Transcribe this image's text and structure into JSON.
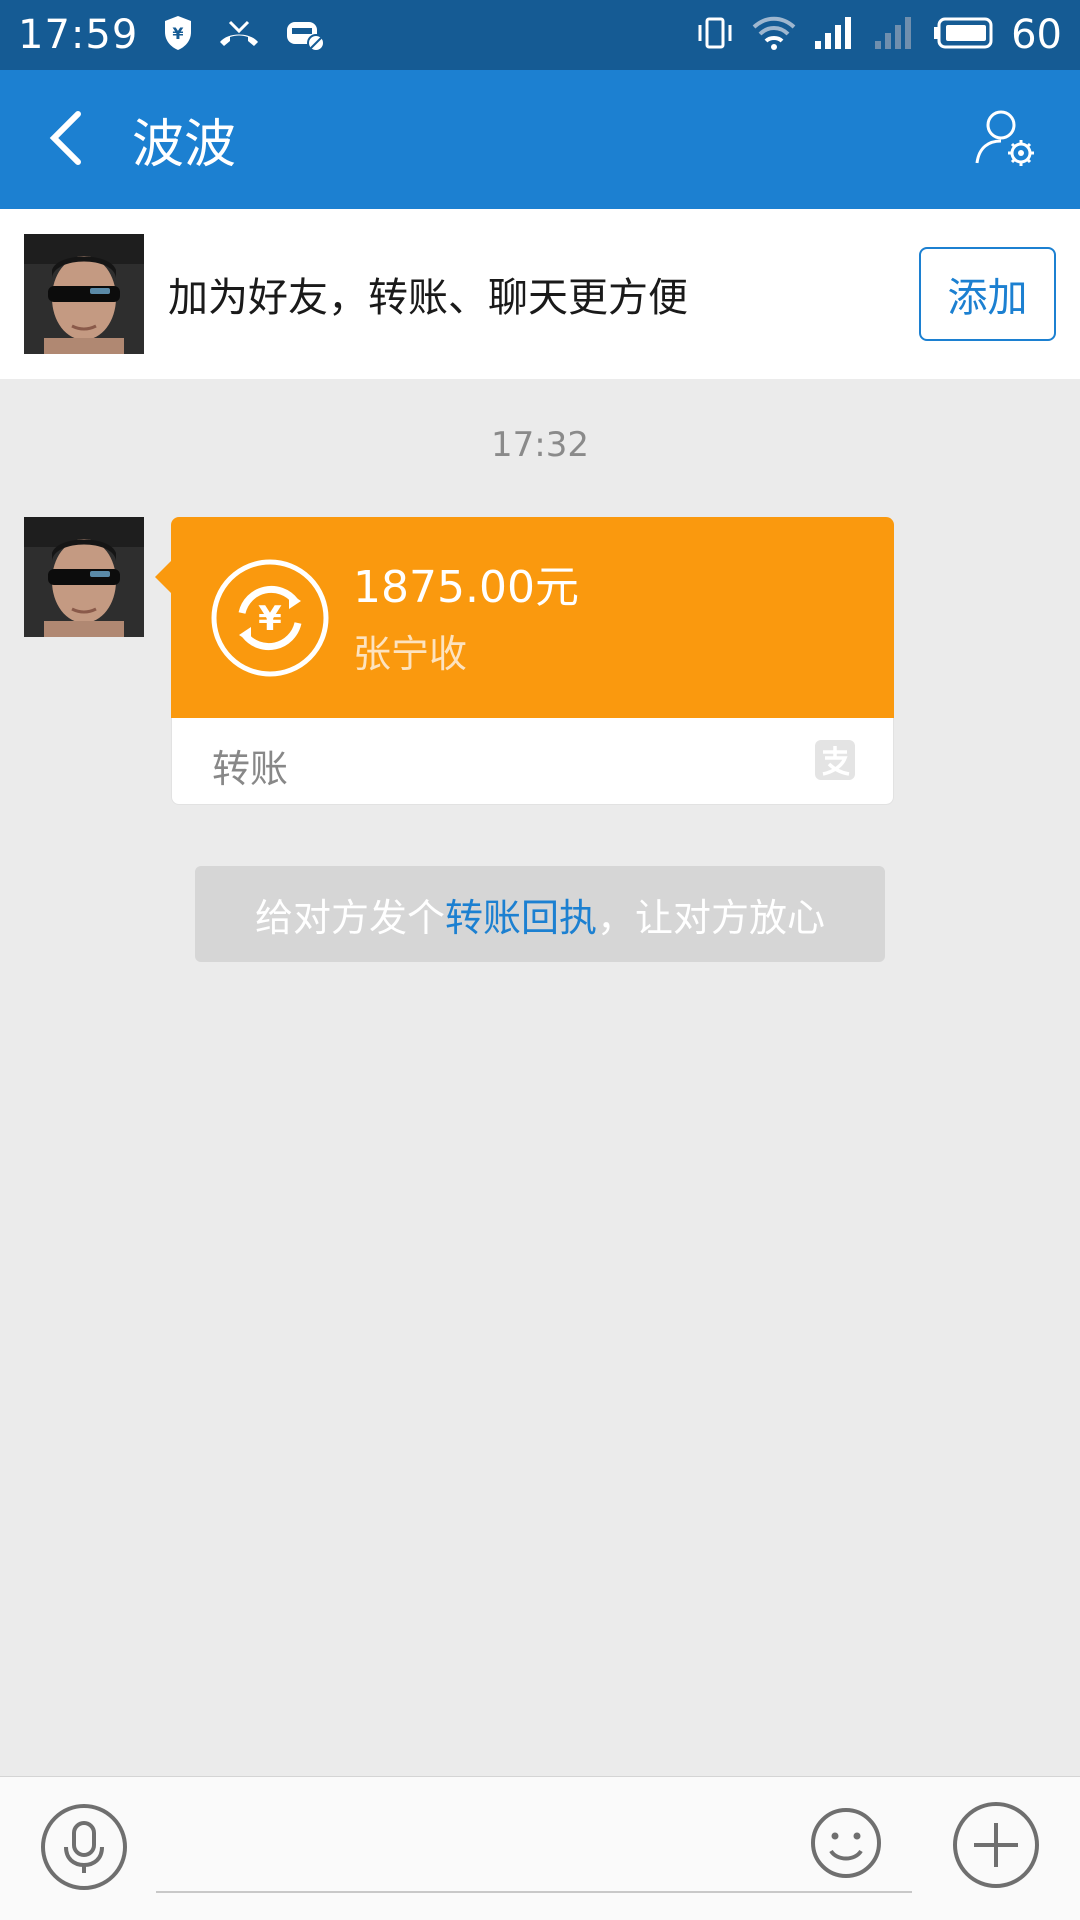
{
  "status_bar": {
    "time": "17:59",
    "battery_level": "60",
    "icons": [
      "alipay-shield-icon",
      "missed-call-icon",
      "car-off-icon",
      "vibrate-icon",
      "wifi-icon",
      "signal-icon",
      "signal-weak-icon",
      "battery-icon"
    ]
  },
  "header": {
    "title": "波波",
    "back_icon": "chevron-left-icon",
    "profile_settings_icon": "user-settings-icon"
  },
  "friend_banner": {
    "text": "加为好友，转账、聊天更方便",
    "add_label": "添加"
  },
  "chat": {
    "timestamp": "17:32",
    "transfer": {
      "amount": "1875.00元",
      "status": "张宁收",
      "label": "转账",
      "icon": "transfer-yuan-icon",
      "brand_icon": "alipay-icon"
    },
    "tip": {
      "prefix": "给对方发个",
      "link": "转账回执",
      "suffix": "，让对方放心"
    }
  },
  "input_bar": {
    "placeholder": "",
    "voice_icon": "microphone-icon",
    "emoji_icon": "smiley-icon",
    "plus_icon": "plus-circle-icon"
  },
  "colors": {
    "status_bar": "#155b94",
    "header": "#1c80d1",
    "transfer_card": "#fa990e",
    "link": "#1c80d1",
    "background": "#ebebeb"
  }
}
